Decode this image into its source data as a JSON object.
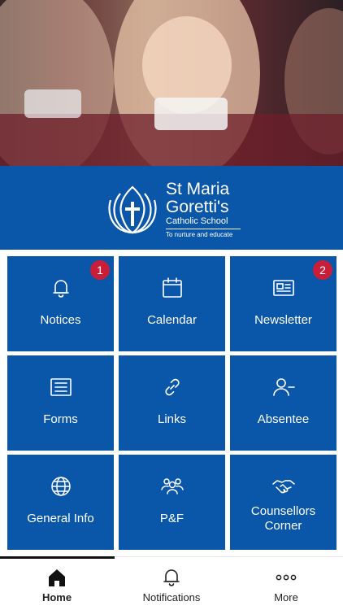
{
  "school": {
    "name_line1": "St Maria",
    "name_line2": "Goretti's",
    "subtitle": "Catholic School",
    "motto": "To nurture and educate"
  },
  "tiles": [
    {
      "label": "Notices",
      "icon": "bell-icon",
      "badge": "1"
    },
    {
      "label": "Calendar",
      "icon": "calendar-icon",
      "badge": ""
    },
    {
      "label": "Newsletter",
      "icon": "newspaper-icon",
      "badge": "2"
    },
    {
      "label": "Forms",
      "icon": "form-icon",
      "badge": ""
    },
    {
      "label": "Links",
      "icon": "link-icon",
      "badge": ""
    },
    {
      "label": "Absentee",
      "icon": "user-minus-icon",
      "badge": ""
    },
    {
      "label": "General Info",
      "icon": "globe-icon",
      "badge": ""
    },
    {
      "label": "P&F",
      "icon": "people-icon",
      "badge": ""
    },
    {
      "label_line1": "Counsellors",
      "label_line2": "Corner",
      "icon": "handshake-icon",
      "badge": ""
    }
  ],
  "tabbar": {
    "home": "Home",
    "notifications": "Notifications",
    "more": "More"
  },
  "colors": {
    "brand_blue": "#0a56a8",
    "badge_red": "#c81e3a"
  }
}
